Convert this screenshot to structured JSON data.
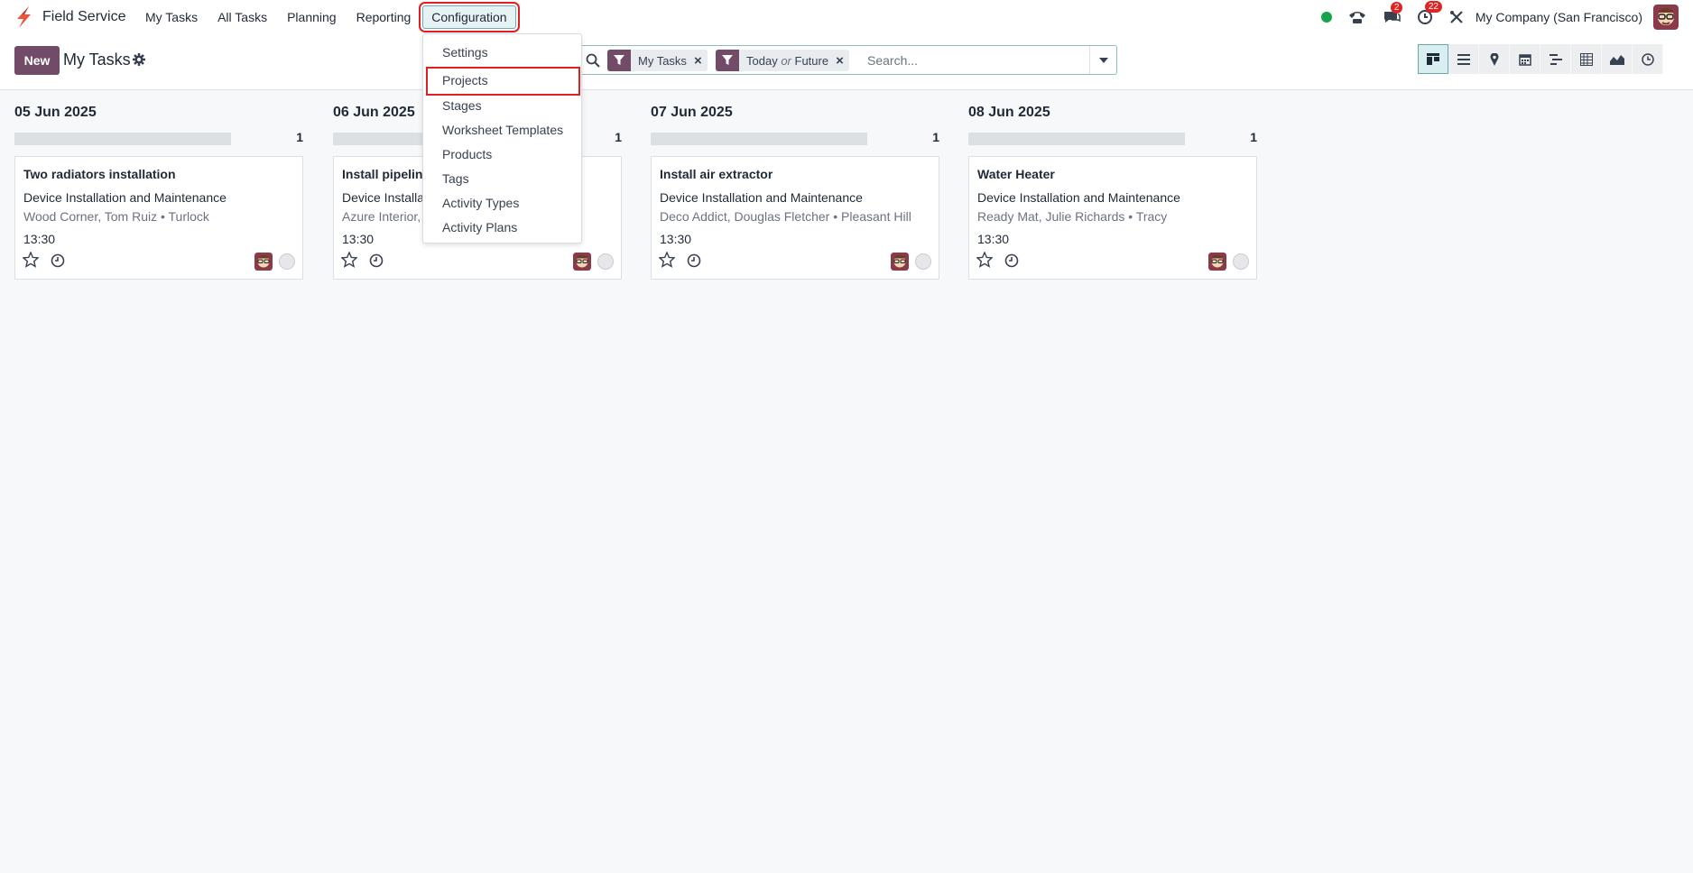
{
  "navbar": {
    "app_name": "Field Service",
    "menu": [
      {
        "label": "My Tasks"
      },
      {
        "label": "All Tasks"
      },
      {
        "label": "Planning"
      },
      {
        "label": "Reporting"
      },
      {
        "label": "Configuration",
        "active": true
      }
    ],
    "systray": {
      "messages_badge": "2",
      "activities_badge": "22",
      "company": "My Company (San Francisco)"
    }
  },
  "control_panel": {
    "new_label": "New",
    "breadcrumb": "My Tasks",
    "search": {
      "facets": [
        {
          "label": "My Tasks"
        },
        {
          "label_a": "Today",
          "or": "or",
          "label_b": "Future"
        }
      ],
      "placeholder": "Search..."
    },
    "views": [
      "kanban-view-icon",
      "list-view-icon",
      "map-view-icon",
      "calendar-view-icon",
      "gantt-view-icon",
      "pivot-view-icon",
      "graph-view-icon",
      "activity-view-icon"
    ],
    "active_view": "kanban"
  },
  "config_menu": {
    "items": [
      {
        "label": "Settings"
      },
      {
        "label": "Projects",
        "highlighted": true
      },
      {
        "label": "Stages"
      },
      {
        "label": "Worksheet Templates"
      },
      {
        "label": "Products"
      },
      {
        "label": "Tags"
      },
      {
        "label": "Activity Types"
      },
      {
        "label": "Activity Plans"
      }
    ]
  },
  "kanban": {
    "columns": [
      {
        "title": "05 Jun 2025",
        "count": "1",
        "card": {
          "title": "Two radiators installation",
          "project": "Device Installation and Maintenance",
          "partner": "Wood Corner, Tom Ruiz • Turlock",
          "time": "13:30"
        }
      },
      {
        "title": "06 Jun 2025",
        "count": "1",
        "card": {
          "title": "Install pipelin",
          "project": "Device Installa",
          "partner": "Azure Interior, I",
          "time": "13:30"
        }
      },
      {
        "title": "07 Jun 2025",
        "count": "1",
        "card": {
          "title": "Install air extractor",
          "project": "Device Installation and Maintenance",
          "partner": "Deco Addict, Douglas Fletcher • Pleasant Hill",
          "time": "13:30"
        }
      },
      {
        "title": "08 Jun 2025",
        "count": "1",
        "card": {
          "title": "Water Heater",
          "project": "Device Installation and Maintenance",
          "partner": "Ready Mat, Julie Richards • Tracy",
          "time": "13:30"
        }
      }
    ]
  },
  "colors": {
    "brand": "#714b67",
    "highlight": "#e02020",
    "online": "#16a34a",
    "badge": "#e02424"
  }
}
